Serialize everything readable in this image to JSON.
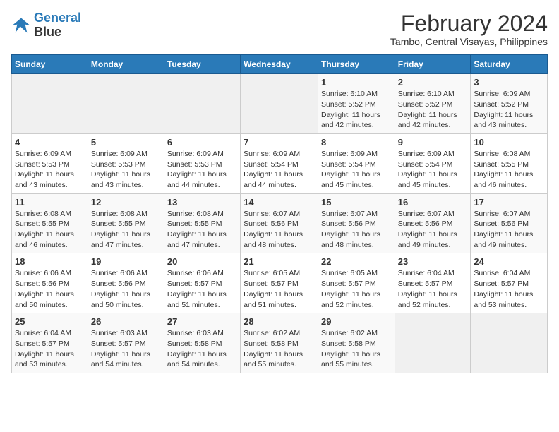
{
  "logo": {
    "text_general": "General",
    "text_blue": "Blue"
  },
  "title": "February 2024",
  "subtitle": "Tambo, Central Visayas, Philippines",
  "days": [
    "Sunday",
    "Monday",
    "Tuesday",
    "Wednesday",
    "Thursday",
    "Friday",
    "Saturday"
  ],
  "weeks": [
    [
      {
        "date": "",
        "info": ""
      },
      {
        "date": "",
        "info": ""
      },
      {
        "date": "",
        "info": ""
      },
      {
        "date": "",
        "info": ""
      },
      {
        "date": "1",
        "info": "Sunrise: 6:10 AM\nSunset: 5:52 PM\nDaylight: 11 hours and 42 minutes."
      },
      {
        "date": "2",
        "info": "Sunrise: 6:10 AM\nSunset: 5:52 PM\nDaylight: 11 hours and 42 minutes."
      },
      {
        "date": "3",
        "info": "Sunrise: 6:09 AM\nSunset: 5:52 PM\nDaylight: 11 hours and 43 minutes."
      }
    ],
    [
      {
        "date": "4",
        "info": "Sunrise: 6:09 AM\nSunset: 5:53 PM\nDaylight: 11 hours and 43 minutes."
      },
      {
        "date": "5",
        "info": "Sunrise: 6:09 AM\nSunset: 5:53 PM\nDaylight: 11 hours and 43 minutes."
      },
      {
        "date": "6",
        "info": "Sunrise: 6:09 AM\nSunset: 5:53 PM\nDaylight: 11 hours and 44 minutes."
      },
      {
        "date": "7",
        "info": "Sunrise: 6:09 AM\nSunset: 5:54 PM\nDaylight: 11 hours and 44 minutes."
      },
      {
        "date": "8",
        "info": "Sunrise: 6:09 AM\nSunset: 5:54 PM\nDaylight: 11 hours and 45 minutes."
      },
      {
        "date": "9",
        "info": "Sunrise: 6:09 AM\nSunset: 5:54 PM\nDaylight: 11 hours and 45 minutes."
      },
      {
        "date": "10",
        "info": "Sunrise: 6:08 AM\nSunset: 5:55 PM\nDaylight: 11 hours and 46 minutes."
      }
    ],
    [
      {
        "date": "11",
        "info": "Sunrise: 6:08 AM\nSunset: 5:55 PM\nDaylight: 11 hours and 46 minutes."
      },
      {
        "date": "12",
        "info": "Sunrise: 6:08 AM\nSunset: 5:55 PM\nDaylight: 11 hours and 47 minutes."
      },
      {
        "date": "13",
        "info": "Sunrise: 6:08 AM\nSunset: 5:55 PM\nDaylight: 11 hours and 47 minutes."
      },
      {
        "date": "14",
        "info": "Sunrise: 6:07 AM\nSunset: 5:56 PM\nDaylight: 11 hours and 48 minutes."
      },
      {
        "date": "15",
        "info": "Sunrise: 6:07 AM\nSunset: 5:56 PM\nDaylight: 11 hours and 48 minutes."
      },
      {
        "date": "16",
        "info": "Sunrise: 6:07 AM\nSunset: 5:56 PM\nDaylight: 11 hours and 49 minutes."
      },
      {
        "date": "17",
        "info": "Sunrise: 6:07 AM\nSunset: 5:56 PM\nDaylight: 11 hours and 49 minutes."
      }
    ],
    [
      {
        "date": "18",
        "info": "Sunrise: 6:06 AM\nSunset: 5:56 PM\nDaylight: 11 hours and 50 minutes."
      },
      {
        "date": "19",
        "info": "Sunrise: 6:06 AM\nSunset: 5:56 PM\nDaylight: 11 hours and 50 minutes."
      },
      {
        "date": "20",
        "info": "Sunrise: 6:06 AM\nSunset: 5:57 PM\nDaylight: 11 hours and 51 minutes."
      },
      {
        "date": "21",
        "info": "Sunrise: 6:05 AM\nSunset: 5:57 PM\nDaylight: 11 hours and 51 minutes."
      },
      {
        "date": "22",
        "info": "Sunrise: 6:05 AM\nSunset: 5:57 PM\nDaylight: 11 hours and 52 minutes."
      },
      {
        "date": "23",
        "info": "Sunrise: 6:04 AM\nSunset: 5:57 PM\nDaylight: 11 hours and 52 minutes."
      },
      {
        "date": "24",
        "info": "Sunrise: 6:04 AM\nSunset: 5:57 PM\nDaylight: 11 hours and 53 minutes."
      }
    ],
    [
      {
        "date": "25",
        "info": "Sunrise: 6:04 AM\nSunset: 5:57 PM\nDaylight: 11 hours and 53 minutes."
      },
      {
        "date": "26",
        "info": "Sunrise: 6:03 AM\nSunset: 5:57 PM\nDaylight: 11 hours and 54 minutes."
      },
      {
        "date": "27",
        "info": "Sunrise: 6:03 AM\nSunset: 5:58 PM\nDaylight: 11 hours and 54 minutes."
      },
      {
        "date": "28",
        "info": "Sunrise: 6:02 AM\nSunset: 5:58 PM\nDaylight: 11 hours and 55 minutes."
      },
      {
        "date": "29",
        "info": "Sunrise: 6:02 AM\nSunset: 5:58 PM\nDaylight: 11 hours and 55 minutes."
      },
      {
        "date": "",
        "info": ""
      },
      {
        "date": "",
        "info": ""
      }
    ]
  ]
}
